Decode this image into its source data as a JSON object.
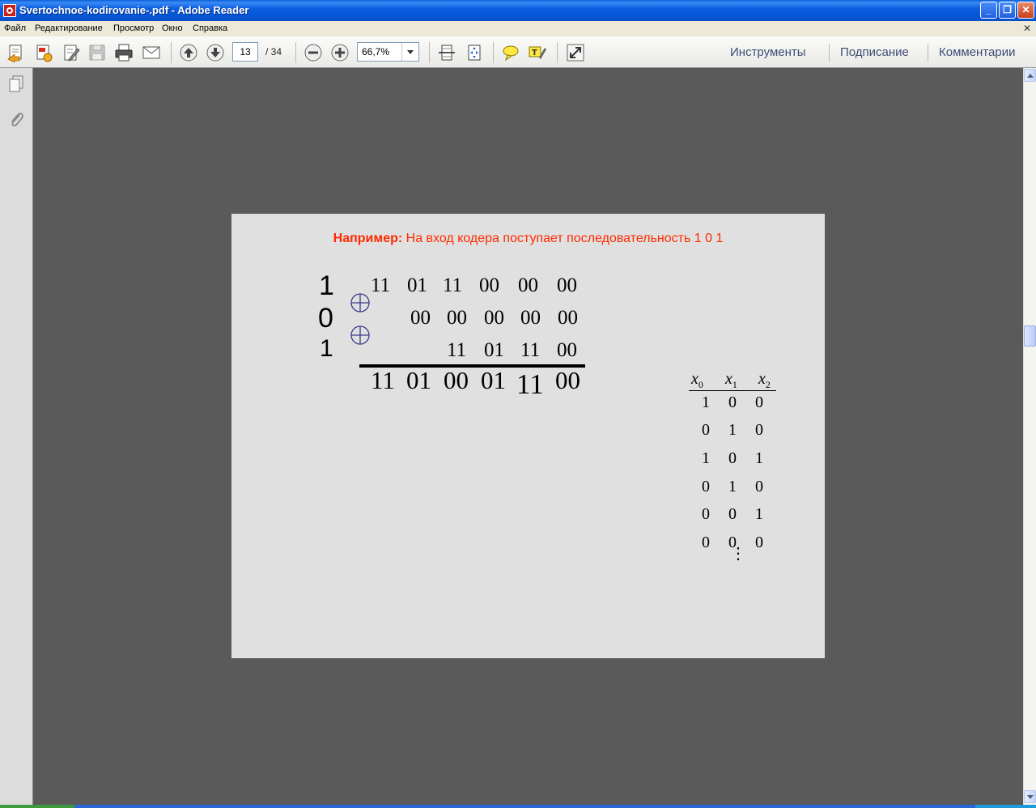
{
  "window": {
    "title": "Svertochnoe-kodirovanie-.pdf - Adobe Reader",
    "minimize_glyph": "_",
    "restore_glyph": "❐",
    "close_glyph": "✕"
  },
  "menu": {
    "items": [
      "Файл",
      "Редактирование",
      "Просмотр",
      "Окно",
      "Справка"
    ],
    "close_glyph": "✕"
  },
  "toolbar": {
    "current_page": "13",
    "total_pages": "/  34",
    "zoom": "66,7%",
    "panels": [
      "Инструменты",
      "Подписание",
      "Комментарии"
    ]
  },
  "document": {
    "heading_bold": "Например:",
    "heading_rest": " На вход кодера поступает последовательность 1 0 1",
    "input_bits": [
      "1",
      "0",
      "1"
    ],
    "rows": [
      [
        "11",
        "01",
        "11",
        "00",
        "00",
        "00"
      ],
      [
        "00",
        "00",
        "00",
        "00",
        "00"
      ],
      [
        "11",
        "01",
        "11",
        "00"
      ]
    ],
    "result": [
      "11",
      "01",
      "00",
      "01",
      "11",
      "00"
    ],
    "state_table": {
      "headers": [
        {
          "var": "x",
          "sub": "0"
        },
        {
          "var": "x",
          "sub": "1"
        },
        {
          "var": "x",
          "sub": "2"
        }
      ],
      "rows": [
        [
          "1",
          "0",
          "0"
        ],
        [
          "0",
          "1",
          "0"
        ],
        [
          "1",
          "0",
          "1"
        ],
        [
          "0",
          "1",
          "0"
        ],
        [
          "0",
          "0",
          "1"
        ],
        [
          "0",
          "0",
          "0"
        ]
      ],
      "continuation": "⋮"
    }
  },
  "colors": {
    "heading": "#ff2a00",
    "xor_symbol": "#3a3a8a",
    "workspace": "#5a5a5a",
    "titlebar": "#0b5fe0"
  }
}
